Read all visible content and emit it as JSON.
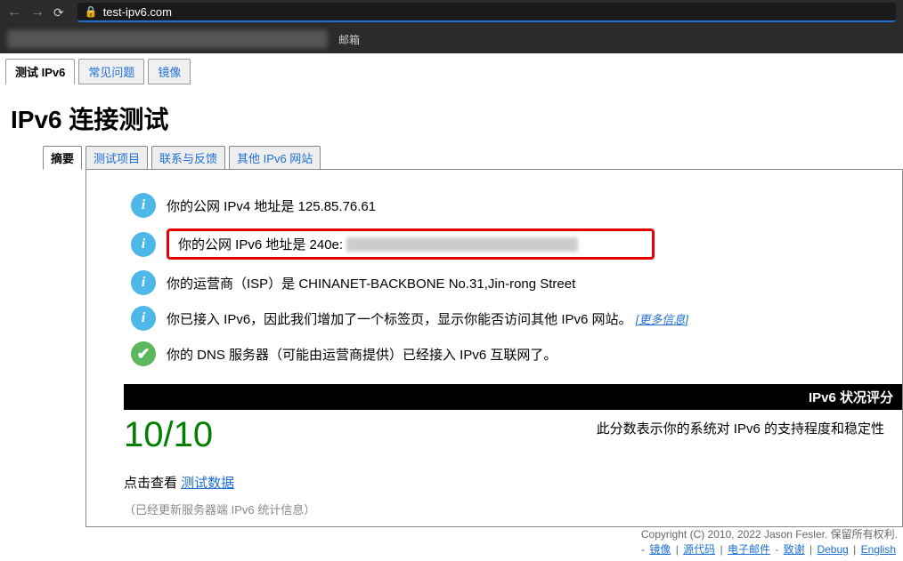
{
  "browser": {
    "url_host": "test-ipv6.com",
    "bookmark_label": "邮箱"
  },
  "top_tabs": [
    {
      "label": "测试 IPv6",
      "active": true
    },
    {
      "label": "常见问题",
      "active": false
    },
    {
      "label": "镜像",
      "active": false
    }
  ],
  "heading": "IPv6 连接测试",
  "inner_tabs": [
    {
      "label": "摘要",
      "active": true
    },
    {
      "label": "测试项目",
      "active": false
    },
    {
      "label": "联系与反馈",
      "active": false
    },
    {
      "label": "其他 IPv6 网站",
      "active": false
    }
  ],
  "rows": {
    "ipv4": {
      "text": "你的公网 IPv4 地址是 125.85.76.61"
    },
    "ipv6": {
      "prefix": "你的公网 IPv6 地址是 240e:"
    },
    "isp": {
      "text": "你的运营商（ISP）是 CHINANET-BACKBONE No.31,Jin-rong Street"
    },
    "tab_added": {
      "text": "你已接入 IPv6，因此我们增加了一个标签页，显示你能否访问其他 IPv6 网站。",
      "link": "[更多信息]"
    },
    "dns": {
      "text": "你的 DNS 服务器（可能由运营商提供）已经接入 IPv6 互联网了。"
    }
  },
  "score": {
    "bar_label": "IPv6 状况评分",
    "value": "10/10",
    "desc": "此分数表示你的系统对 IPv6 的支持程度和稳定性"
  },
  "click_view": {
    "label": "点击查看 ",
    "link": "测试数据"
  },
  "stats_note": "（已经更新服务器端 IPv6 统计信息）",
  "footer": {
    "copyright": "Copyright (C) 2010, 2022 Jason Fesler. 保留所有权利.",
    "links": [
      "镜像",
      "源代码",
      "电子邮件",
      "致谢",
      "Debug",
      "English"
    ]
  }
}
